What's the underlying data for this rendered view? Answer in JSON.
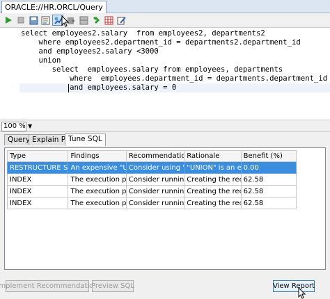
{
  "window": {
    "title": "ORACLE://HR.ORCL/Query"
  },
  "toolbar": {
    "buttons": [
      "run-icon",
      "stop-icon",
      "save-icon",
      "tune-sql-icon",
      "explain-plan-icon",
      "export-icon",
      "pivot-icon",
      "grid-icon",
      "edit-icon"
    ]
  },
  "editor": {
    "lines": [
      "select employees2.salary  from employees2, departments2",
      "    where employees2.department_id = departments2.department_id",
      "    and employees2.salary <3000",
      "    union",
      "       select  employees.salary from employees, departments",
      "           where  employees.department_id = departments.department_id",
      "           and employees.salary = 0"
    ]
  },
  "status": {
    "zoom": "100 %"
  },
  "tabs": [
    "Query",
    "Explain Plan",
    "Tune SQL"
  ],
  "table": {
    "headers": [
      "Type",
      "Findings",
      "Recommendations",
      "Rationale",
      "Benefit (%)"
    ],
    "rows": [
      [
        "RESTRUCTURE SQL",
        "An expensive \"U...",
        "Consider using \"U...",
        "\"UNION\" is an e...",
        "0.00"
      ],
      [
        "INDEX",
        "The execution pl...",
        "Consider running ...",
        "Creating the rec...",
        "62.58"
      ],
      [
        "INDEX",
        "The execution pl...",
        "Consider running ...",
        "Creating the rec...",
        "62.58"
      ],
      [
        "INDEX",
        "The execution pl...",
        "Consider running ...",
        "Creating the rec...",
        "62.58"
      ]
    ]
  },
  "buttons": {
    "implement": "Implement Recommendation",
    "preview": "Preview SQL",
    "view_report": "View Report"
  },
  "colors": {
    "selection": "#3b8ede",
    "run": "#2e9b2e",
    "stop": "#c03030"
  }
}
